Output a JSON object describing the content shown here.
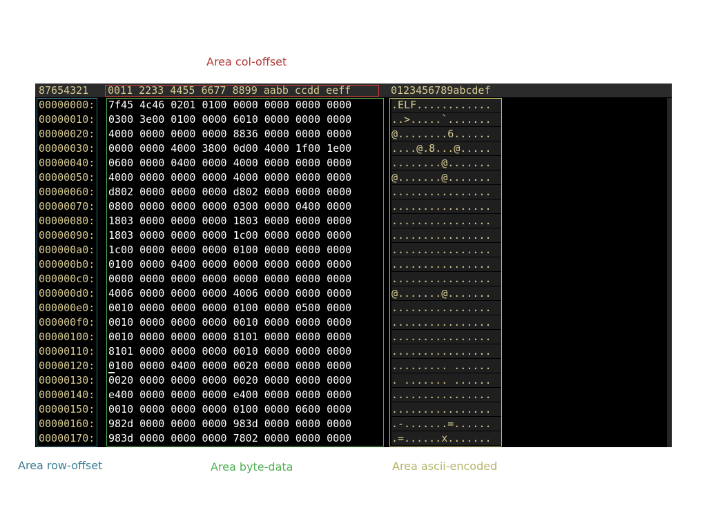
{
  "labels": {
    "col_offset": "Area col-offset",
    "row_offset": "Area row-offset",
    "byte_data": "Area byte-data",
    "ascii_encoded": "Area ascii-encoded"
  },
  "header": {
    "row_header": "87654321",
    "col_header": "0011 2233 4455 6677 8899 aabb ccdd eeff",
    "ascii_header": "0123456789abcdef"
  },
  "rows": [
    {
      "offset": "00000000:",
      "bytes": "7f45 4c46 0201 0100 0000 0000 0000 0000",
      "ascii": ".ELF............"
    },
    {
      "offset": "00000010:",
      "bytes": "0300 3e00 0100 0000 6010 0000 0000 0000",
      "ascii": "..>.....`......."
    },
    {
      "offset": "00000020:",
      "bytes": "4000 0000 0000 0000 8836 0000 0000 0000",
      "ascii": "@........6......"
    },
    {
      "offset": "00000030:",
      "bytes": "0000 0000 4000 3800 0d00 4000 1f00 1e00",
      "ascii": "....@.8...@....."
    },
    {
      "offset": "00000040:",
      "bytes": "0600 0000 0400 0000 4000 0000 0000 0000",
      "ascii": "........@......."
    },
    {
      "offset": "00000050:",
      "bytes": "4000 0000 0000 0000 4000 0000 0000 0000",
      "ascii": "@.......@......."
    },
    {
      "offset": "00000060:",
      "bytes": "d802 0000 0000 0000 d802 0000 0000 0000",
      "ascii": "................"
    },
    {
      "offset": "00000070:",
      "bytes": "0800 0000 0000 0000 0300 0000 0400 0000",
      "ascii": "................"
    },
    {
      "offset": "00000080:",
      "bytes": "1803 0000 0000 0000 1803 0000 0000 0000",
      "ascii": "................"
    },
    {
      "offset": "00000090:",
      "bytes": "1803 0000 0000 0000 1c00 0000 0000 0000",
      "ascii": "................"
    },
    {
      "offset": "000000a0:",
      "bytes": "1c00 0000 0000 0000 0100 0000 0000 0000",
      "ascii": "................"
    },
    {
      "offset": "000000b0:",
      "bytes": "0100 0000 0400 0000 0000 0000 0000 0000",
      "ascii": "................"
    },
    {
      "offset": "000000c0:",
      "bytes": "0000 0000 0000 0000 0000 0000 0000 0000",
      "ascii": "................"
    },
    {
      "offset": "000000d0:",
      "bytes": "4006 0000 0000 0000 4006 0000 0000 0000",
      "ascii": "@.......@......."
    },
    {
      "offset": "000000e0:",
      "bytes": "0010 0000 0000 0000 0100 0000 0500 0000",
      "ascii": "................"
    },
    {
      "offset": "000000f0:",
      "bytes": "0010 0000 0000 0000 0010 0000 0000 0000",
      "ascii": "................"
    },
    {
      "offset": "00000100:",
      "bytes": "0010 0000 0000 0000 8101 0000 0000 0000",
      "ascii": "................"
    },
    {
      "offset": "00000110:",
      "bytes": "8101 0000 0000 0000 0010 0000 0000 0000",
      "ascii": "................"
    },
    {
      "offset": "00000120:",
      "bytes": "0100 0000 0400 0000 0020 0000 0000 0000",
      "ascii": "......... ......"
    },
    {
      "offset": "00000130:",
      "bytes": "0020 0000 0000 0000 0020 0000 0000 0000",
      "ascii": ". ....... ......"
    },
    {
      "offset": "00000140:",
      "bytes": "e400 0000 0000 0000 e400 0000 0000 0000",
      "ascii": "................"
    },
    {
      "offset": "00000150:",
      "bytes": "0010 0000 0000 0000 0100 0000 0600 0000",
      "ascii": "................"
    },
    {
      "offset": "00000160:",
      "bytes": "982d 0000 0000 0000 983d 0000 0000 0000",
      "ascii": ".-.......=......"
    },
    {
      "offset": "00000170:",
      "bytes": "983d 0000 0000 0000 7802 0000 0000 0000",
      "ascii": ".=......x......."
    }
  ]
}
